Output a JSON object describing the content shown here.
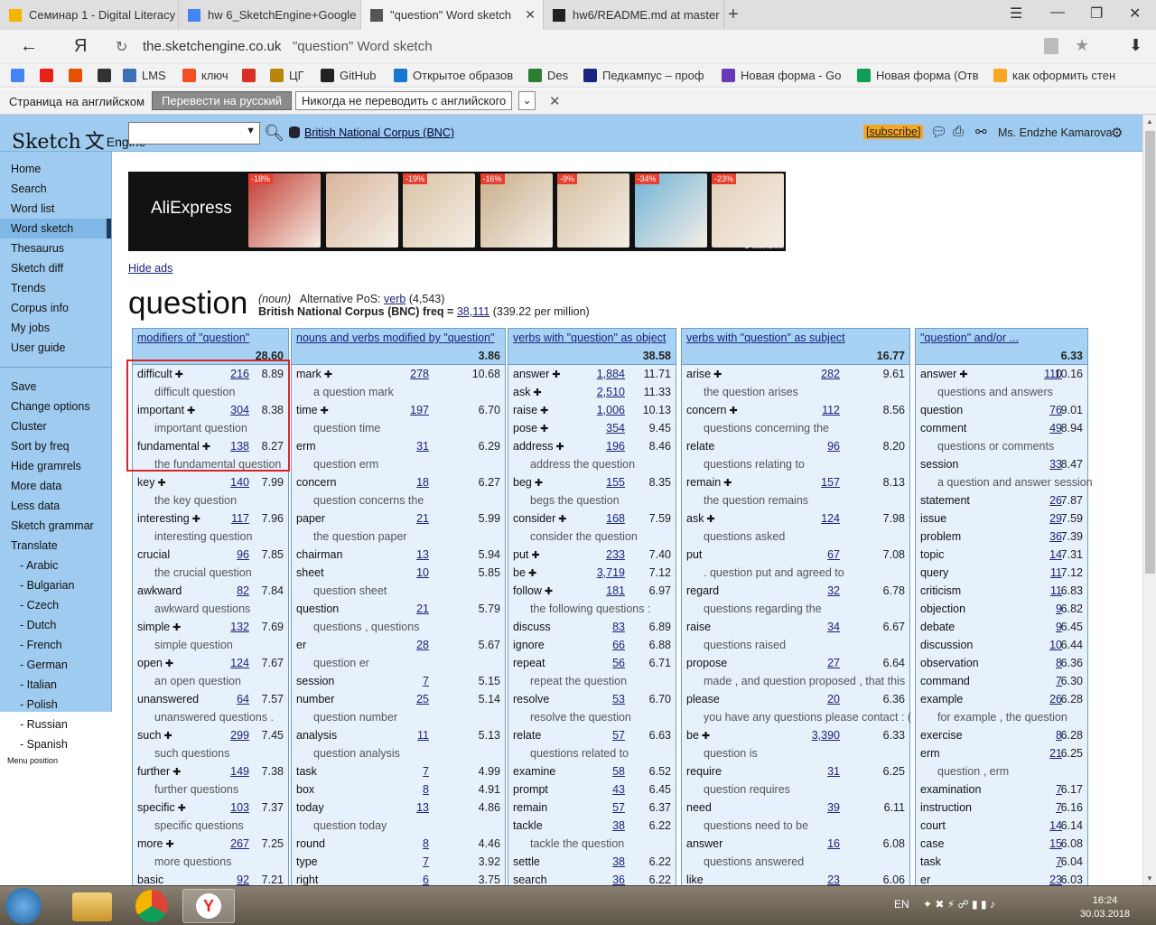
{
  "browser": {
    "tabs": [
      {
        "label": "Семинар 1 - Digital Literacy",
        "icon": "doc-icon",
        "color": "#f4b400"
      },
      {
        "label": "hw 6_SketchEngine+Google",
        "icon": "gdoc-icon",
        "color": "#4285f4"
      },
      {
        "label": "\"question\" Word sketch",
        "icon": "sketchengine-icon",
        "color": "#555555"
      },
      {
        "label": "hw6/README.md at master",
        "icon": "github-icon",
        "color": "#222222"
      }
    ],
    "url_host": "the.sketchengine.co.uk",
    "url_title": "\"question\" Word sketch",
    "bookmarks": [
      {
        "label": "",
        "color": "#4285f4"
      },
      {
        "label": "",
        "color": "#e62117"
      },
      {
        "label": "",
        "color": "#e65100"
      },
      {
        "label": "",
        "color": "#333333"
      },
      {
        "label": "LMS",
        "color": "#3b6fb6"
      },
      {
        "label": "ключ",
        "color": "#f25022"
      },
      {
        "label": "",
        "color": "#d93025"
      },
      {
        "label": "ЦГ",
        "color": "#b8860b"
      },
      {
        "label": "GitHub",
        "color": "#222222"
      },
      {
        "label": "Открытое образов",
        "color": "#1976d2"
      },
      {
        "label": "Des",
        "color": "#2e7d32"
      },
      {
        "label": "Педкампус – проф",
        "color": "#1a237e"
      },
      {
        "label": "Новая форма - Go",
        "color": "#673ab7"
      },
      {
        "label": "Новая форма (Отв",
        "color": "#0f9d58"
      },
      {
        "label": "как оформить стен",
        "color": "#f9a825"
      }
    ],
    "translate": {
      "text": "Страница на английском",
      "btn_translate": "Перевести на русский",
      "btn_never": "Никогда не переводить с английского"
    }
  },
  "header": {
    "logo_left": "Sketch",
    "logo_mid": "文",
    "logo_right": "Engine",
    "corpus": "British National Corpus (BNC)",
    "subscribe": "[subscribe]",
    "user": "Ms. Endzhe Kamarova"
  },
  "sidebar": {
    "items": [
      "Home",
      "Search",
      "Word list",
      "Word sketch",
      "Thesaurus",
      "Sketch diff",
      "Trends",
      "Corpus info",
      "My jobs",
      "User guide"
    ],
    "current": "Word sketch",
    "actions": [
      "Save",
      "Change options",
      "Cluster",
      "Sort by freq",
      "Hide gramrels",
      "More data",
      "Less data",
      "Sketch grammar",
      "Translate"
    ],
    "languages": [
      "- Arabic",
      "- Bulgarian",
      "- Czech",
      "- Dutch",
      "- French",
      "- German",
      "- Italian",
      "- Polish",
      "- Russian",
      "- Spanish"
    ],
    "menu_position": "Menu position"
  },
  "ad": {
    "brand": "AliExpress",
    "discounts": [
      "-18%",
      "",
      "-19%",
      "-16%",
      "-9%",
      "-34%",
      "-23%"
    ],
    "company": "О компании",
    "hide": "Hide ads"
  },
  "headword": {
    "word": "question",
    "pos": "(noun)",
    "alt_label": "Alternative PoS:",
    "alt_pos": "verb",
    "alt_count": "(4,543)",
    "freq_label": "British National Corpus (BNC) freq =",
    "freq": "38,111",
    "per_million": "(339.22 per million)"
  },
  "columns": [
    {
      "title": "modifiers of \"question\"",
      "score": "28.60",
      "rows": [
        [
          "difficult",
          1,
          "216",
          "8.89"
        ],
        [
          "difficult question"
        ],
        [
          "important",
          1,
          "304",
          "8.38"
        ],
        [
          "important question"
        ],
        [
          "fundamental",
          1,
          "138",
          "8.27"
        ],
        [
          "the fundamental question"
        ],
        [
          "key",
          1,
          "140",
          "7.99"
        ],
        [
          "the key question"
        ],
        [
          "interesting",
          1,
          "117",
          "7.96"
        ],
        [
          "interesting question"
        ],
        [
          "crucial",
          0,
          "96",
          "7.85"
        ],
        [
          "the crucial question"
        ],
        [
          "awkward",
          0,
          "82",
          "7.84"
        ],
        [
          "awkward questions"
        ],
        [
          "simple",
          1,
          "132",
          "7.69"
        ],
        [
          "simple question"
        ],
        [
          "open",
          1,
          "124",
          "7.67"
        ],
        [
          "an open question"
        ],
        [
          "unanswered",
          0,
          "64",
          "7.57"
        ],
        [
          "unanswered questions ."
        ],
        [
          "such",
          1,
          "299",
          "7.45"
        ],
        [
          "such questions"
        ],
        [
          "further",
          1,
          "149",
          "7.38"
        ],
        [
          "further questions"
        ],
        [
          "specific",
          1,
          "103",
          "7.37"
        ],
        [
          "specific questions"
        ],
        [
          "more",
          1,
          "267",
          "7.25"
        ],
        [
          "more questions"
        ],
        [
          "basic",
          0,
          "92",
          "7.21"
        ]
      ]
    },
    {
      "title": "nouns and verbs modified by \"question\"",
      "score": "3.86",
      "rows": [
        [
          "mark",
          1,
          "278",
          "10.68"
        ],
        [
          "a question mark"
        ],
        [
          "time",
          1,
          "197",
          "6.70"
        ],
        [
          "question time"
        ],
        [
          "erm",
          0,
          "31",
          "6.29"
        ],
        [
          "question erm"
        ],
        [
          "concern",
          0,
          "18",
          "6.27"
        ],
        [
          "question concerns the"
        ],
        [
          "paper",
          0,
          "21",
          "5.99"
        ],
        [
          "the question paper"
        ],
        [
          "chairman",
          0,
          "13",
          "5.94"
        ],
        [
          "sheet",
          0,
          "10",
          "5.85"
        ],
        [
          "question sheet"
        ],
        [
          "question",
          0,
          "21",
          "5.79"
        ],
        [
          "questions , questions"
        ],
        [
          "er",
          0,
          "28",
          "5.67"
        ],
        [
          "question er"
        ],
        [
          "session",
          0,
          "7",
          "5.15"
        ],
        [
          "number",
          0,
          "25",
          "5.14"
        ],
        [
          "question number"
        ],
        [
          "analysis",
          0,
          "11",
          "5.13"
        ],
        [
          "question analysis"
        ],
        [
          "task",
          0,
          "7",
          "4.99"
        ],
        [
          "box",
          0,
          "8",
          "4.91"
        ],
        [
          "today",
          0,
          "13",
          "4.86"
        ],
        [
          "question today"
        ],
        [
          "round",
          0,
          "8",
          "4.46"
        ],
        [
          "type",
          0,
          "7",
          "3.92"
        ],
        [
          "right",
          0,
          "6",
          "3.75"
        ]
      ]
    },
    {
      "title": "verbs with \"question\" as object",
      "score": "38.58",
      "rows": [
        [
          "answer",
          1,
          "1,884",
          "11.71"
        ],
        [
          "ask",
          1,
          "2,510",
          "11.33"
        ],
        [
          "raise",
          1,
          "1,006",
          "10.13"
        ],
        [
          "pose",
          1,
          "354",
          "9.45"
        ],
        [
          "address",
          1,
          "196",
          "8.46"
        ],
        [
          "address the question"
        ],
        [
          "beg",
          1,
          "155",
          "8.35"
        ],
        [
          "begs the question"
        ],
        [
          "consider",
          1,
          "168",
          "7.59"
        ],
        [
          "consider the question"
        ],
        [
          "put",
          1,
          "233",
          "7.40"
        ],
        [
          "be",
          1,
          "3,719",
          "7.12"
        ],
        [
          "follow",
          1,
          "181",
          "6.97"
        ],
        [
          "the following questions :"
        ],
        [
          "discuss",
          0,
          "83",
          "6.89"
        ],
        [
          "ignore",
          0,
          "66",
          "6.88"
        ],
        [
          "repeat",
          0,
          "56",
          "6.71"
        ],
        [
          "repeat the question"
        ],
        [
          "resolve",
          0,
          "53",
          "6.70"
        ],
        [
          "resolve the question"
        ],
        [
          "relate",
          0,
          "57",
          "6.63"
        ],
        [
          "questions related to"
        ],
        [
          "examine",
          0,
          "58",
          "6.52"
        ],
        [
          "prompt",
          0,
          "43",
          "6.45"
        ],
        [
          "remain",
          0,
          "57",
          "6.37"
        ],
        [
          "tackle",
          0,
          "38",
          "6.22"
        ],
        [
          "tackle the question"
        ],
        [
          "settle",
          0,
          "38",
          "6.22"
        ],
        [
          "search",
          0,
          "36",
          "6.22"
        ]
      ]
    },
    {
      "title": "verbs with \"question\" as subject",
      "score": "16.77",
      "rows": [
        [
          "arise",
          1,
          "282",
          "9.61"
        ],
        [
          "the question arises"
        ],
        [
          "concern",
          1,
          "112",
          "8.56"
        ],
        [
          "questions concerning the"
        ],
        [
          "relate",
          0,
          "96",
          "8.20"
        ],
        [
          "questions relating to"
        ],
        [
          "remain",
          1,
          "157",
          "8.13"
        ],
        [
          "the question remains"
        ],
        [
          "ask",
          1,
          "124",
          "7.98"
        ],
        [
          "questions asked"
        ],
        [
          "put",
          0,
          "67",
          "7.08"
        ],
        [
          ". question put and agreed to"
        ],
        [
          "regard",
          0,
          "32",
          "6.78"
        ],
        [
          "questions regarding the"
        ],
        [
          "raise",
          0,
          "34",
          "6.67"
        ],
        [
          "questions raised"
        ],
        [
          "propose",
          0,
          "27",
          "6.64"
        ],
        [
          "made , and question proposed , that this"
        ],
        [
          "please",
          0,
          "20",
          "6.36"
        ],
        [
          "you have any questions please contact : ("
        ],
        [
          "be",
          1,
          "3,390",
          "6.33"
        ],
        [
          "question is"
        ],
        [
          "require",
          0,
          "31",
          "6.25"
        ],
        [
          "question requires"
        ],
        [
          "need",
          0,
          "39",
          "6.11"
        ],
        [
          "questions need to be"
        ],
        [
          "answer",
          0,
          "16",
          "6.08"
        ],
        [
          "questions answered"
        ],
        [
          "like",
          0,
          "23",
          "6.06"
        ]
      ]
    },
    {
      "title": "\"question\" and/or ...",
      "score": "6.33",
      "rows": [
        [
          "answer",
          1,
          "110",
          "10.16"
        ],
        [
          "questions and answers"
        ],
        [
          "question",
          0,
          "76",
          "9.01"
        ],
        [
          "comment",
          0,
          "49",
          "8.94"
        ],
        [
          "questions or comments"
        ],
        [
          "session",
          0,
          "33",
          "8.47"
        ],
        [
          "a question and answer session"
        ],
        [
          "statement",
          0,
          "26",
          "7.87"
        ],
        [
          "issue",
          0,
          "29",
          "7.59"
        ],
        [
          "problem",
          0,
          "36",
          "7.39"
        ],
        [
          "topic",
          0,
          "14",
          "7.31"
        ],
        [
          "query",
          0,
          "11",
          "7.12"
        ],
        [
          "criticism",
          0,
          "11",
          "6.83"
        ],
        [
          "objection",
          0,
          "9",
          "6.82"
        ],
        [
          "debate",
          0,
          "9",
          "6.45"
        ],
        [
          "discussion",
          0,
          "10",
          "6.44"
        ],
        [
          "observation",
          0,
          "8",
          "6.36"
        ],
        [
          "command",
          0,
          "7",
          "6.30"
        ],
        [
          "example",
          0,
          "26",
          "6.28"
        ],
        [
          "for example , the question"
        ],
        [
          "exercise",
          0,
          "8",
          "6.28"
        ],
        [
          "erm",
          0,
          "21",
          "6.25"
        ],
        [
          "question , erm"
        ],
        [
          "examination",
          0,
          "7",
          "6.17"
        ],
        [
          "instruction",
          0,
          "7",
          "6.16"
        ],
        [
          "court",
          0,
          "14",
          "6.14"
        ],
        [
          "case",
          0,
          "15",
          "6.08"
        ],
        [
          "task",
          0,
          "7",
          "6.04"
        ],
        [
          "er",
          0,
          "23",
          "6.03"
        ]
      ]
    }
  ],
  "taskbar": {
    "lang": "EN",
    "time": "16:24",
    "date": "30.03.2018"
  }
}
